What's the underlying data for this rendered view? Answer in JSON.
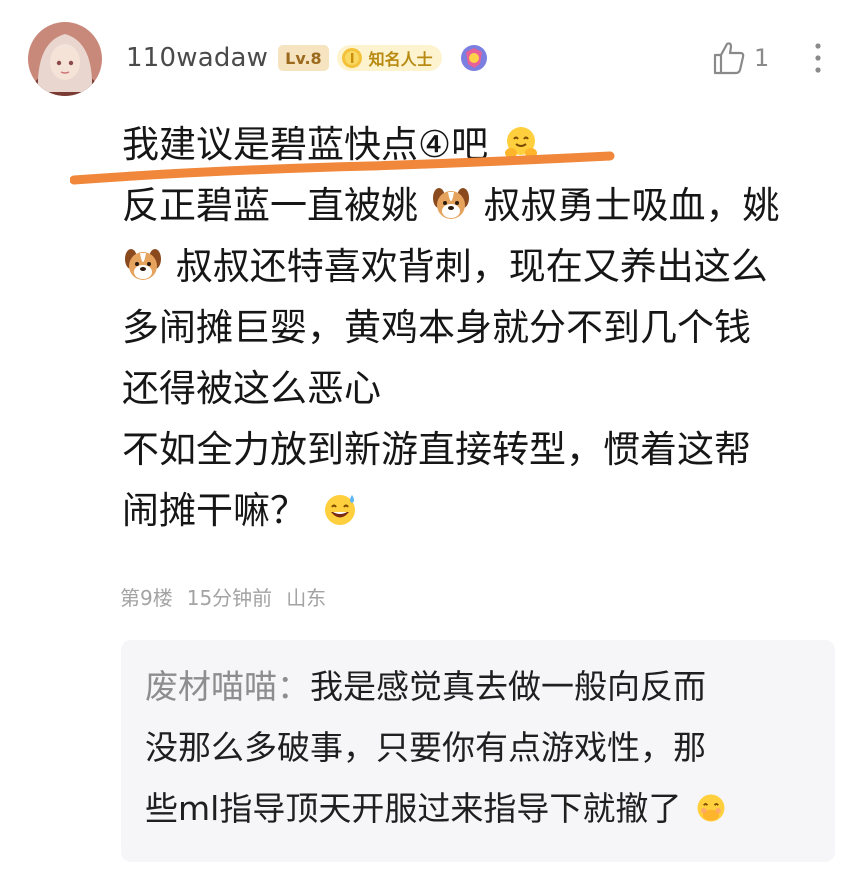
{
  "post": {
    "username": "110wadaw",
    "level": "Lv.8",
    "title_badge": "知名人士",
    "like_count": "1",
    "lines": [
      "我建议是碧蓝快点④吧",
      "反正碧蓝一直被姚",
      "叔叔勇士吸血，姚",
      "叔叔还特喜欢背刺，现在又养出这么",
      "多闹摊巨婴，黄鸡本身就分不到几个钱",
      "还得被这么恶心",
      "不如全力放到新游直接转型，惯着这帮",
      "闹摊干嘛？"
    ],
    "floor": "第9楼",
    "time": "15分钟前",
    "location": "山东"
  },
  "reply": {
    "author": "废材喵喵：",
    "lines": [
      "我是感觉真去做一般向反而",
      "没那么多破事，只要你有点游戏性，那",
      "些ml指导顶天开服过来指导下就撤了"
    ]
  },
  "colors": {
    "underline": "#f0873a",
    "meta": "#a3a3a3",
    "reply_bg": "#f6f6f9",
    "level_bg": "#f6e3c0"
  },
  "icons": [
    "avatar",
    "coin-icon",
    "medal-icon",
    "thumbs-up-icon",
    "more-icon",
    "hug-emoji",
    "dog-emoji",
    "sweat-smile-emoji",
    "shy-emoji"
  ]
}
